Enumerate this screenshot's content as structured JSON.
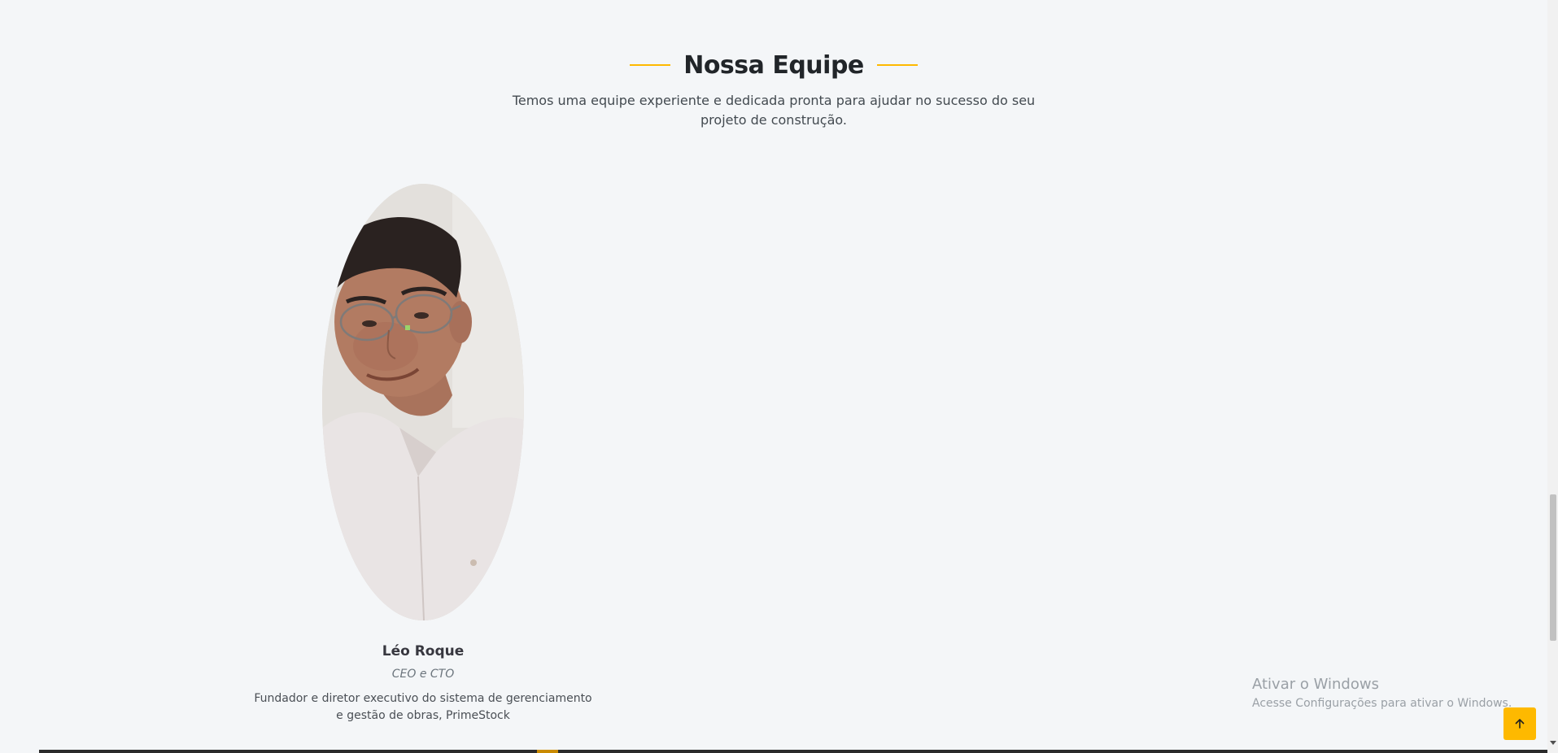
{
  "section": {
    "title": "Nossa Equipe",
    "subtitle": "Temos uma equipe experiente e dedicada pronta para ajudar no sucesso do seu projeto de construção."
  },
  "team": [
    {
      "name": "Léo Roque",
      "role": "CEO e CTO",
      "description": "Fundador e diretor executivo do sistema de gerenciamento e gestão de obras, PrimeStock"
    }
  ],
  "windows_watermark": {
    "title": "Ativar o Windows",
    "subtitle": "Acesse Configurações para ativar o Windows."
  },
  "colors": {
    "accent": "#feb900",
    "background": "#f4f6f8",
    "heading": "#212529"
  },
  "icons": {
    "scroll_top": "arrow-up-icon"
  }
}
